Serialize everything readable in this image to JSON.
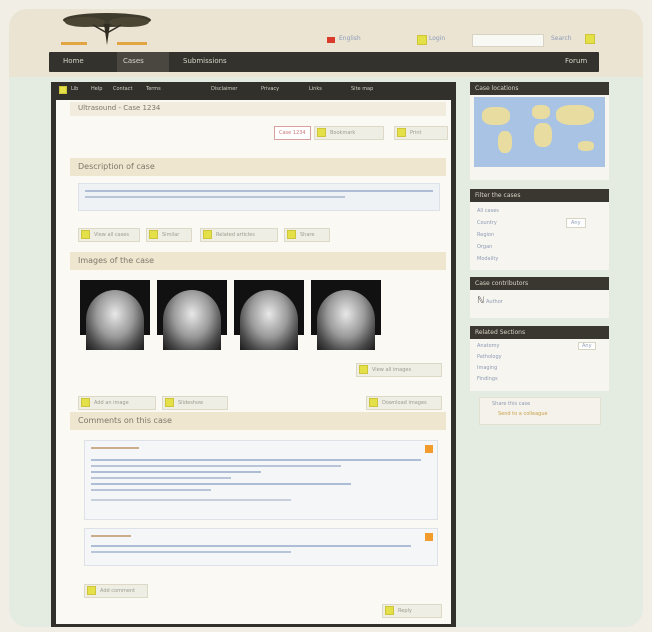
{
  "nav": {
    "items": [
      "Home",
      "Cases",
      "Submissions"
    ],
    "right": "Forum"
  },
  "utils": {
    "links": [
      "English",
      "Login",
      "Search"
    ]
  },
  "subnav": [
    "Lib",
    "Help",
    "Contact",
    "Terms",
    "Disclaimer",
    "Privacy",
    "Links",
    "Site map"
  ],
  "case": {
    "title": "Ultrasound - Case 1234",
    "tag": "Case 1234",
    "actions": [
      "Bookmark",
      "Print"
    ]
  },
  "description": {
    "title": "Description of case",
    "toolbar": [
      "View all cases",
      "Similar",
      "Related articles",
      "Share"
    ]
  },
  "images": {
    "title": "Images of the case",
    "more_button": "View all images",
    "actions": [
      "Add an image",
      "Slideshow",
      "Download images"
    ]
  },
  "comments": {
    "title": "Comments on this case",
    "add_button": "Add comment",
    "reply_button": "Reply"
  },
  "sidebar": {
    "map_title": "Case locations",
    "filter_title": "Filter the cases",
    "filter_items": [
      "All cases",
      "Country",
      "Region",
      "Organ",
      "Modality"
    ],
    "filter_select": "Any",
    "author_title": "Case contributors",
    "author_name": "Author",
    "stats_title": "Related Sections",
    "stats_items": [
      "Anatomy",
      "Pathology",
      "Imaging",
      "Findings"
    ],
    "stats_value": "Any",
    "footer_text": "Share this case",
    "footer_link": "Send to a colleague"
  },
  "colors": {
    "navbar": "#34322d",
    "accent": "#e4e047",
    "section_head": "#efe6cf",
    "link": "#8b9bb8"
  }
}
